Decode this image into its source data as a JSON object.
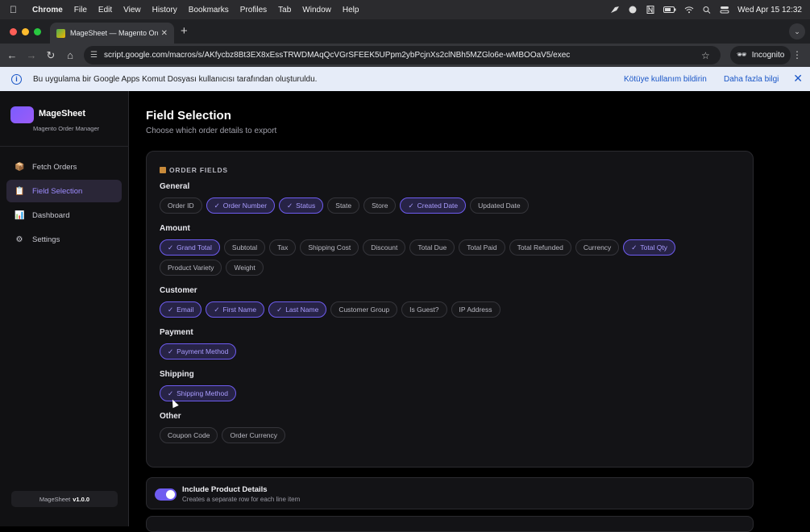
{
  "menubar": {
    "app": "Chrome",
    "items": [
      "File",
      "Edit",
      "View",
      "History",
      "Bookmarks",
      "Profiles",
      "Tab",
      "Window",
      "Help"
    ],
    "clock": "Wed Apr 15  12:32"
  },
  "browser": {
    "tab_title": "MageSheet — Magento Order",
    "url": "script.google.com/macros/s/AKfycbz8Bt3EX8xEssTRWDMAqQcVGrSFEEK5UPpm2ybPcjnXs2clNBh5MZGlo6e-wMBOOaV5/exec",
    "incognito_label": "Incognito"
  },
  "infobar": {
    "message": "Bu uygulama bir Google Apps Komut Dosyası kullanıcısı tarafından oluşturuldu.",
    "report_link": "Kötüye kullanım bildirin",
    "more_link": "Daha fazla bilgi"
  },
  "sidebar": {
    "brand": "MageSheet",
    "tagline": "Magento Order Manager",
    "items": [
      {
        "label": "Fetch Orders",
        "icon": "package-icon"
      },
      {
        "label": "Field Selection",
        "icon": "clipboard-icon"
      },
      {
        "label": "Dashboard",
        "icon": "chart-icon"
      },
      {
        "label": "Settings",
        "icon": "gear-icon"
      }
    ],
    "version_prefix": "MageSheet",
    "version": "v1.0.0"
  },
  "main": {
    "title": "Field Selection",
    "subtitle": "Choose which order details to export",
    "section_heading": "ORDER FIELDS",
    "groups": [
      {
        "title": "General",
        "fields": [
          {
            "label": "Order ID",
            "on": false
          },
          {
            "label": "Order Number",
            "on": true
          },
          {
            "label": "Status",
            "on": true
          },
          {
            "label": "State",
            "on": false
          },
          {
            "label": "Store",
            "on": false
          },
          {
            "label": "Created Date",
            "on": true
          },
          {
            "label": "Updated Date",
            "on": false
          }
        ]
      },
      {
        "title": "Amount",
        "fields": [
          {
            "label": "Grand Total",
            "on": true
          },
          {
            "label": "Subtotal",
            "on": false
          },
          {
            "label": "Tax",
            "on": false
          },
          {
            "label": "Shipping Cost",
            "on": false
          },
          {
            "label": "Discount",
            "on": false
          },
          {
            "label": "Total Due",
            "on": false
          },
          {
            "label": "Total Paid",
            "on": false
          },
          {
            "label": "Total Refunded",
            "on": false
          },
          {
            "label": "Currency",
            "on": false
          },
          {
            "label": "Total Qty",
            "on": true
          },
          {
            "label": "Product Variety",
            "on": false
          },
          {
            "label": "Weight",
            "on": false
          }
        ]
      },
      {
        "title": "Customer",
        "fields": [
          {
            "label": "Email",
            "on": true
          },
          {
            "label": "First Name",
            "on": true
          },
          {
            "label": "Last Name",
            "on": true
          },
          {
            "label": "Customer Group",
            "on": false
          },
          {
            "label": "Is Guest?",
            "on": false
          },
          {
            "label": "IP Address",
            "on": false
          }
        ]
      },
      {
        "title": "Payment",
        "fields": [
          {
            "label": "Payment Method",
            "on": true
          }
        ]
      },
      {
        "title": "Shipping",
        "fields": [
          {
            "label": "Shipping Method",
            "on": true
          }
        ]
      },
      {
        "title": "Other",
        "fields": [
          {
            "label": "Coupon Code",
            "on": false
          },
          {
            "label": "Order Currency",
            "on": false
          }
        ]
      }
    ],
    "toggle": {
      "title": "Include Product Details",
      "subtitle": "Creates a separate row for each line item",
      "on": true
    }
  },
  "colors": {
    "accent": "#6e5cf0",
    "accent_text": "#a99cff",
    "background": "#000000",
    "card": "#131316"
  }
}
